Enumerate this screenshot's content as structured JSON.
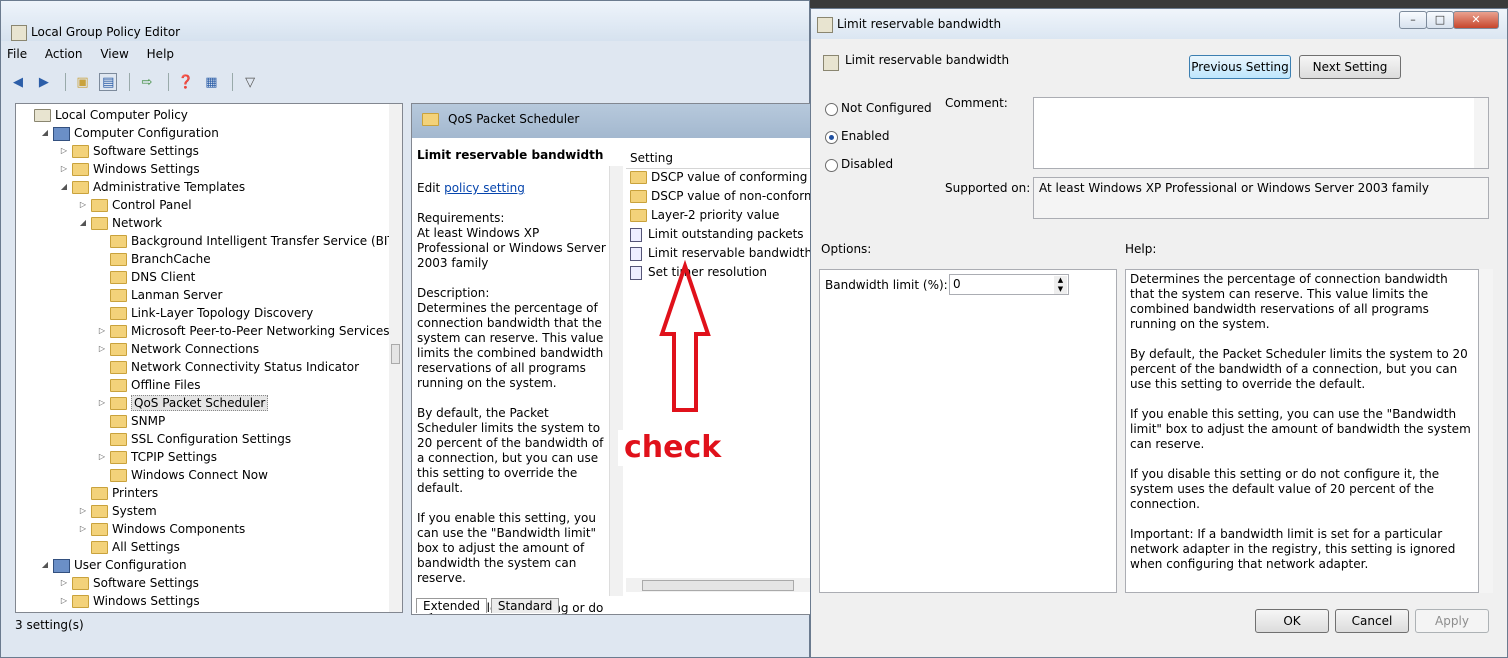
{
  "main_window": {
    "title": "Local Group Policy Editor",
    "menu": [
      "File",
      "Action",
      "View",
      "Help"
    ],
    "status": "3 setting(s)"
  },
  "tree": {
    "nodes": [
      {
        "label": "Local Computer Policy",
        "depth": 0,
        "tri": "",
        "icon": "policy"
      },
      {
        "label": "Computer Configuration",
        "depth": 1,
        "tri": "open",
        "icon": "pc"
      },
      {
        "label": "Software Settings",
        "depth": 2,
        "tri": "closed",
        "icon": "folder"
      },
      {
        "label": "Windows Settings",
        "depth": 2,
        "tri": "closed",
        "icon": "folder"
      },
      {
        "label": "Administrative Templates",
        "depth": 2,
        "tri": "open",
        "icon": "folder"
      },
      {
        "label": "Control Panel",
        "depth": 3,
        "tri": "closed",
        "icon": "folder"
      },
      {
        "label": "Network",
        "depth": 3,
        "tri": "open",
        "icon": "folder"
      },
      {
        "label": "Background Intelligent Transfer Service (BITS)",
        "depth": 4,
        "tri": "",
        "icon": "folder"
      },
      {
        "label": "BranchCache",
        "depth": 4,
        "tri": "",
        "icon": "folder"
      },
      {
        "label": "DNS Client",
        "depth": 4,
        "tri": "",
        "icon": "folder"
      },
      {
        "label": "Lanman Server",
        "depth": 4,
        "tri": "",
        "icon": "folder"
      },
      {
        "label": "Link-Layer Topology Discovery",
        "depth": 4,
        "tri": "",
        "icon": "folder"
      },
      {
        "label": "Microsoft Peer-to-Peer Networking Services",
        "depth": 4,
        "tri": "closed",
        "icon": "folder"
      },
      {
        "label": "Network Connections",
        "depth": 4,
        "tri": "closed",
        "icon": "folder"
      },
      {
        "label": "Network Connectivity Status Indicator",
        "depth": 4,
        "tri": "",
        "icon": "folder"
      },
      {
        "label": "Offline Files",
        "depth": 4,
        "tri": "",
        "icon": "folder"
      },
      {
        "label": "QoS Packet Scheduler",
        "depth": 4,
        "tri": "closed",
        "icon": "folder",
        "selected": true
      },
      {
        "label": "SNMP",
        "depth": 4,
        "tri": "",
        "icon": "folder"
      },
      {
        "label": "SSL Configuration Settings",
        "depth": 4,
        "tri": "",
        "icon": "folder"
      },
      {
        "label": "TCPIP Settings",
        "depth": 4,
        "tri": "closed",
        "icon": "folder"
      },
      {
        "label": "Windows Connect Now",
        "depth": 4,
        "tri": "",
        "icon": "folder"
      },
      {
        "label": "Printers",
        "depth": 3,
        "tri": "",
        "icon": "folder"
      },
      {
        "label": "System",
        "depth": 3,
        "tri": "closed",
        "icon": "folder"
      },
      {
        "label": "Windows Components",
        "depth": 3,
        "tri": "closed",
        "icon": "folder"
      },
      {
        "label": "All Settings",
        "depth": 3,
        "tri": "",
        "icon": "folder"
      },
      {
        "label": "User Configuration",
        "depth": 1,
        "tri": "open",
        "icon": "pc"
      },
      {
        "label": "Software Settings",
        "depth": 2,
        "tri": "closed",
        "icon": "folder"
      },
      {
        "label": "Windows Settings",
        "depth": 2,
        "tri": "closed",
        "icon": "folder"
      }
    ]
  },
  "middle": {
    "header": "QoS Packet Scheduler",
    "desc_title": "Limit reservable bandwidth",
    "edit_prefix": "Edit",
    "edit_link": "policy setting",
    "requirements_label": "Requirements:",
    "requirements": "At least Windows XP Professional or Windows Server 2003 family",
    "description_label": "Description:",
    "desc_paragraphs": [
      "Determines the percentage of connection bandwidth that the system can reserve. This value limits the combined bandwidth reservations of all programs running on the system.",
      "By default, the Packet Scheduler limits the system to 20 percent of the bandwidth of a connection, but you can use this setting to override the default.",
      "If you enable this setting, you can use the \"Bandwidth limit\" box to adjust the amount of bandwidth the system can reserve.",
      "If you disable this setting or do not configure it, the system uses the default value of 20 percent of"
    ],
    "column_header": "Setting",
    "items": [
      {
        "label": "DSCP value of conforming pack",
        "icon": "folder"
      },
      {
        "label": "DSCP value of non-conforming",
        "icon": "folder"
      },
      {
        "label": "Layer-2 priority value",
        "icon": "folder"
      },
      {
        "label": "Limit outstanding packets",
        "icon": "policy"
      },
      {
        "label": "Limit reservable bandwidth",
        "icon": "policy"
      },
      {
        "label": "Set timer resolution",
        "icon": "policy"
      }
    ],
    "tabs": [
      "Extended",
      "Standard"
    ]
  },
  "annotation": {
    "text": "check",
    "color": "#e0111b"
  },
  "dialog": {
    "title": "Limit reservable bandwidth",
    "setting_name": "Limit reservable bandwidth",
    "prev_button": "Previous Setting",
    "next_button": "Next Setting",
    "radios": [
      {
        "label": "Not Configured",
        "checked": false
      },
      {
        "label": "Enabled",
        "checked": true
      },
      {
        "label": "Disabled",
        "checked": false
      }
    ],
    "comment_label": "Comment:",
    "supported_label": "Supported on:",
    "supported_value": "At least Windows XP Professional or Windows Server 2003 family",
    "options_label": "Options:",
    "help_label": "Help:",
    "bandwidth_label": "Bandwidth limit (%):",
    "bandwidth_value": "0",
    "help_paragraphs": [
      "Determines the percentage of connection bandwidth that the system can reserve. This value limits the combined bandwidth reservations of all programs running on the system.",
      "By default, the Packet Scheduler limits the system to 20 percent of the bandwidth of a connection, but you can use this setting to override the default.",
      "If you enable this setting, you can use the \"Bandwidth limit\" box to adjust the amount of bandwidth the system can reserve.",
      "If you disable this setting or do not configure it, the system uses the default value of 20 percent of the connection.",
      "Important: If a bandwidth limit is set for a particular network adapter in the registry, this setting is ignored when configuring that network adapter."
    ],
    "ok_button": "OK",
    "cancel_button": "Cancel",
    "apply_button": "Apply"
  }
}
